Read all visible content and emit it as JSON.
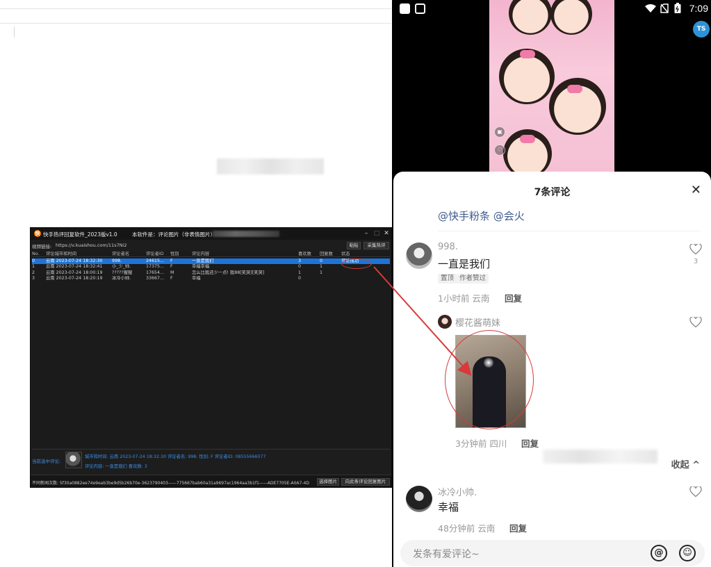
{
  "desktop_app": {
    "logo_glyph": "快",
    "title": "快手热评回复软件_2023版v1.0",
    "subtitle": "本软件是：评论图片（非表情图片）",
    "window_controls": {
      "minimize": "–",
      "maximize": "□",
      "close": "✕"
    },
    "url_label": "视频链接:",
    "url_value": "https://v.kuaishou.com/11s7Ni2",
    "buttons": {
      "paste": "粘贴",
      "collect": "采集热评",
      "select_image": "选择图片",
      "reply_image": "向此条评论回复图片"
    },
    "table": {
      "headers": [
        "No.",
        "评论城市和时间",
        "评论者名",
        "评论者ID",
        "性别",
        "评论内容",
        "喜欢数",
        "回复数",
        "状态"
      ],
      "rows": [
        [
          "0",
          "云南  2023-07-24 18:32:30",
          "998.",
          "24615...",
          "F",
          "一直是我们",
          "3",
          "0",
          "评论成功"
        ],
        [
          "1",
          "云南  2023-07-24 18:32:41",
          "小_少_帅.",
          "17375...",
          "F",
          "幸福幸福",
          "0",
          "1",
          ""
        ],
        [
          "2",
          "云南  2023-07-24 18:00:19",
          "?????猩猩",
          "17654...",
          "M",
          "怎么比我还少一点! 我88[笑哭][笑哭]",
          "1",
          "1",
          ""
        ],
        [
          "3",
          "云南  2023-07-24 18:20:19",
          "冰冷小帅.",
          "33667...",
          "F",
          "幸福",
          "0",
          "",
          ""
        ]
      ],
      "selected_row": 0
    },
    "current_label": "当前选中评论:",
    "current_line1": "城市和时间: 云南 2023-07-24 18:32:30  评论者名: 998.  性别: F  评论者ID: 08555666077",
    "current_line2": "评论内容: 一直是我们  喜欢数: 3",
    "footer": "不同新闻次数: 5f30a0882ee74e9eab3be9d5b26b70e-3623790403——775667bab60a31a9697ac1964aa3b1f1——ADE7705E-A0A7-4D"
  },
  "phone": {
    "status_time": "7:09",
    "ts_badge": "TS",
    "sheet_title": "7条评论",
    "close_glyph": "✕",
    "mention_line": "@快手粉条 @会火",
    "comments": [
      {
        "name": "998.",
        "text": "一直是我们",
        "tags": [
          "置顶",
          "作者赞过"
        ],
        "meta": "1小时前 云南",
        "reply": "回复",
        "likes": "3"
      },
      {
        "name": "樱花酱萌妹",
        "text": "",
        "meta": "3分钟前 四川",
        "reply": "回复",
        "likes": ""
      },
      {
        "name": "冰冷小帅.",
        "text": "幸福",
        "meta": "48分钟前 云南",
        "reply": "回复",
        "likes": ""
      }
    ],
    "collapse": "收起 ^",
    "input_placeholder": "发条有爱评论~",
    "input_icons": {
      "at": "@",
      "emoji": "☺"
    }
  },
  "colors": {
    "selection_blue": "#1e74d6",
    "annotation_red": "#d63a3a",
    "mention_blue": "#3e5a8c"
  }
}
